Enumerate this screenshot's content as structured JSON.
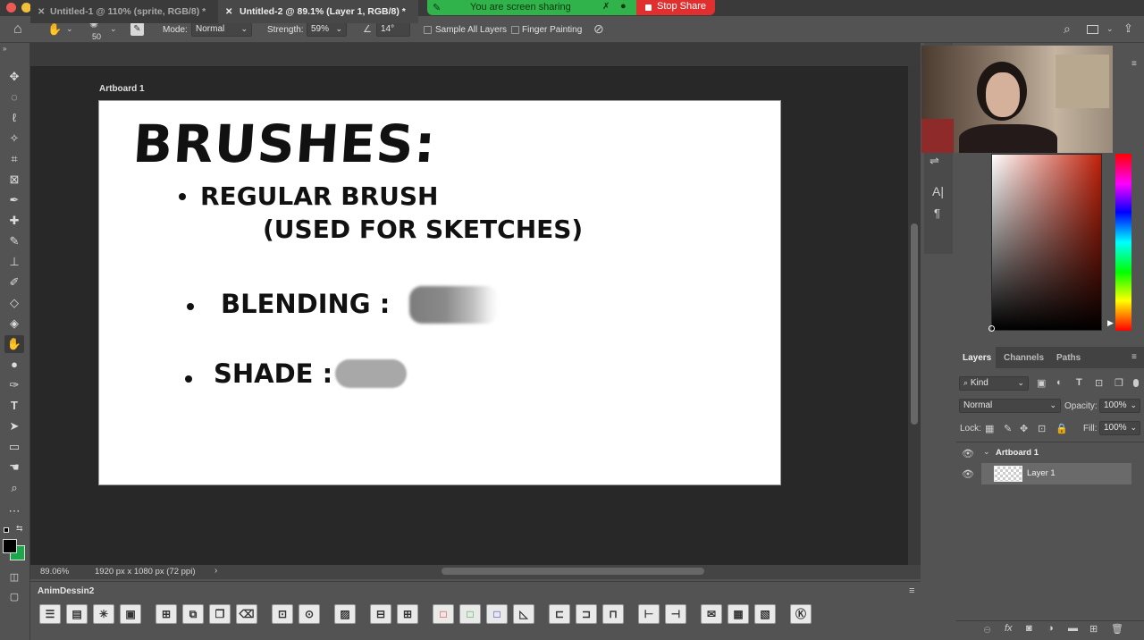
{
  "screen_share": {
    "status": "You are screen sharing",
    "stop_label": "Stop Share"
  },
  "options_bar": {
    "brush_size": "50",
    "mode_label": "Mode:",
    "mode_value": "Normal",
    "strength_label": "Strength:",
    "strength_value": "59%",
    "angle_value": "14°",
    "sample_all_layers": "Sample All Layers",
    "finger_painting": "Finger Painting"
  },
  "tabs": [
    {
      "label": "Untitled-1 @ 110% (sprite, RGB/8) *",
      "active": false
    },
    {
      "label": "Untitled-2 @ 89.1% (Layer 1, RGB/8) *",
      "active": true
    }
  ],
  "artboard": {
    "name": "Artboard 1",
    "title": "BRUSHES:",
    "items": [
      {
        "line1": "REGULAR BRUSH",
        "line2": "(USED FOR SKETCHES)"
      },
      {
        "line1": "BLENDING :"
      },
      {
        "line1": "SHADE :"
      }
    ]
  },
  "status": {
    "zoom": "89.06%",
    "doc_size": "1920 px x 1080 px (72 ppi)"
  },
  "anim_panel": {
    "title": "AnimDessin2"
  },
  "layers_panel": {
    "tabs": [
      "Layers",
      "Channels",
      "Paths"
    ],
    "kind_label": "Kind",
    "blend_mode": "Normal",
    "opacity_label": "Opacity:",
    "opacity_value": "100%",
    "lock_label": "Lock:",
    "fill_label": "Fill:",
    "fill_value": "100%",
    "layers": [
      {
        "name": "Artboard 1",
        "type": "artboard"
      },
      {
        "name": "Layer 1",
        "type": "layer",
        "selected": true
      }
    ]
  },
  "colors": {
    "foreground": "#000000",
    "background": "#1aa84a",
    "accent_share": "#2fb34a",
    "stop_share": "#e02f2f"
  }
}
